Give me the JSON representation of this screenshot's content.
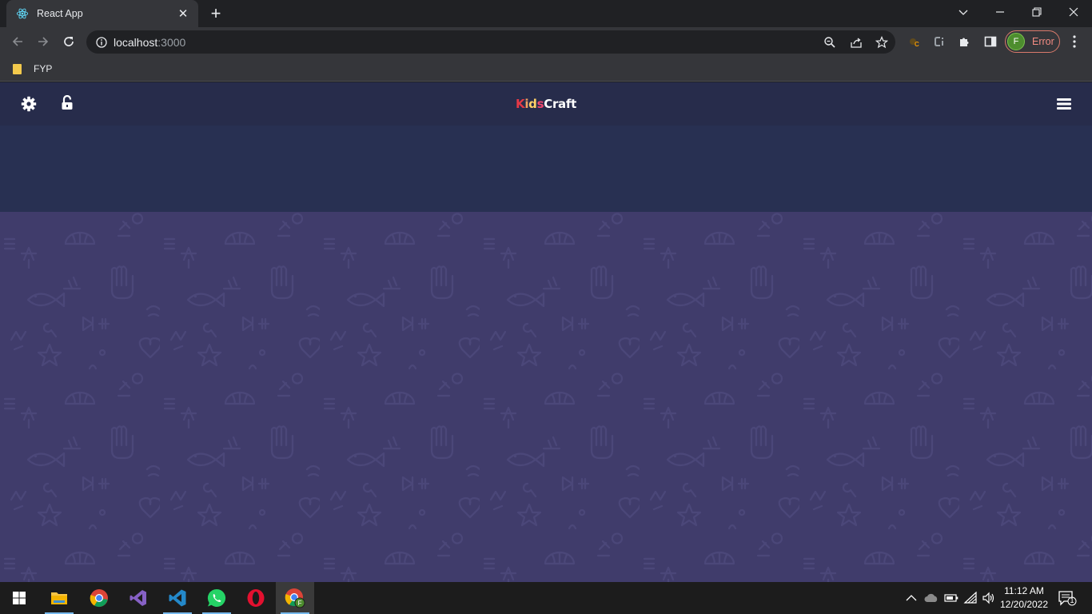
{
  "browser": {
    "tab": {
      "title": "React App",
      "favicon": "react-icon"
    },
    "url": {
      "host": "localhost",
      "port": ":3000"
    },
    "profile": {
      "initial": "F",
      "status": "Error"
    },
    "bookmarks": [
      {
        "label": "FYP",
        "icon": "folder-icon"
      }
    ]
  },
  "app": {
    "brand": {
      "part1": "K",
      "part2": "i",
      "part3": "d",
      "part4": "s",
      "part5": "Craft"
    },
    "colors": {
      "header": "#272c4b",
      "hero": "#283052",
      "content": "#403c6b"
    }
  },
  "taskbar": {
    "apps": [
      "start-icon",
      "file-explorer-icon",
      "chrome-icon",
      "visual-studio-icon",
      "vscode-icon",
      "whatsapp-icon",
      "opera-icon",
      "chrome-profile-icon"
    ],
    "time": "11:12 AM",
    "date": "12/20/2022",
    "notification_count": "1"
  }
}
